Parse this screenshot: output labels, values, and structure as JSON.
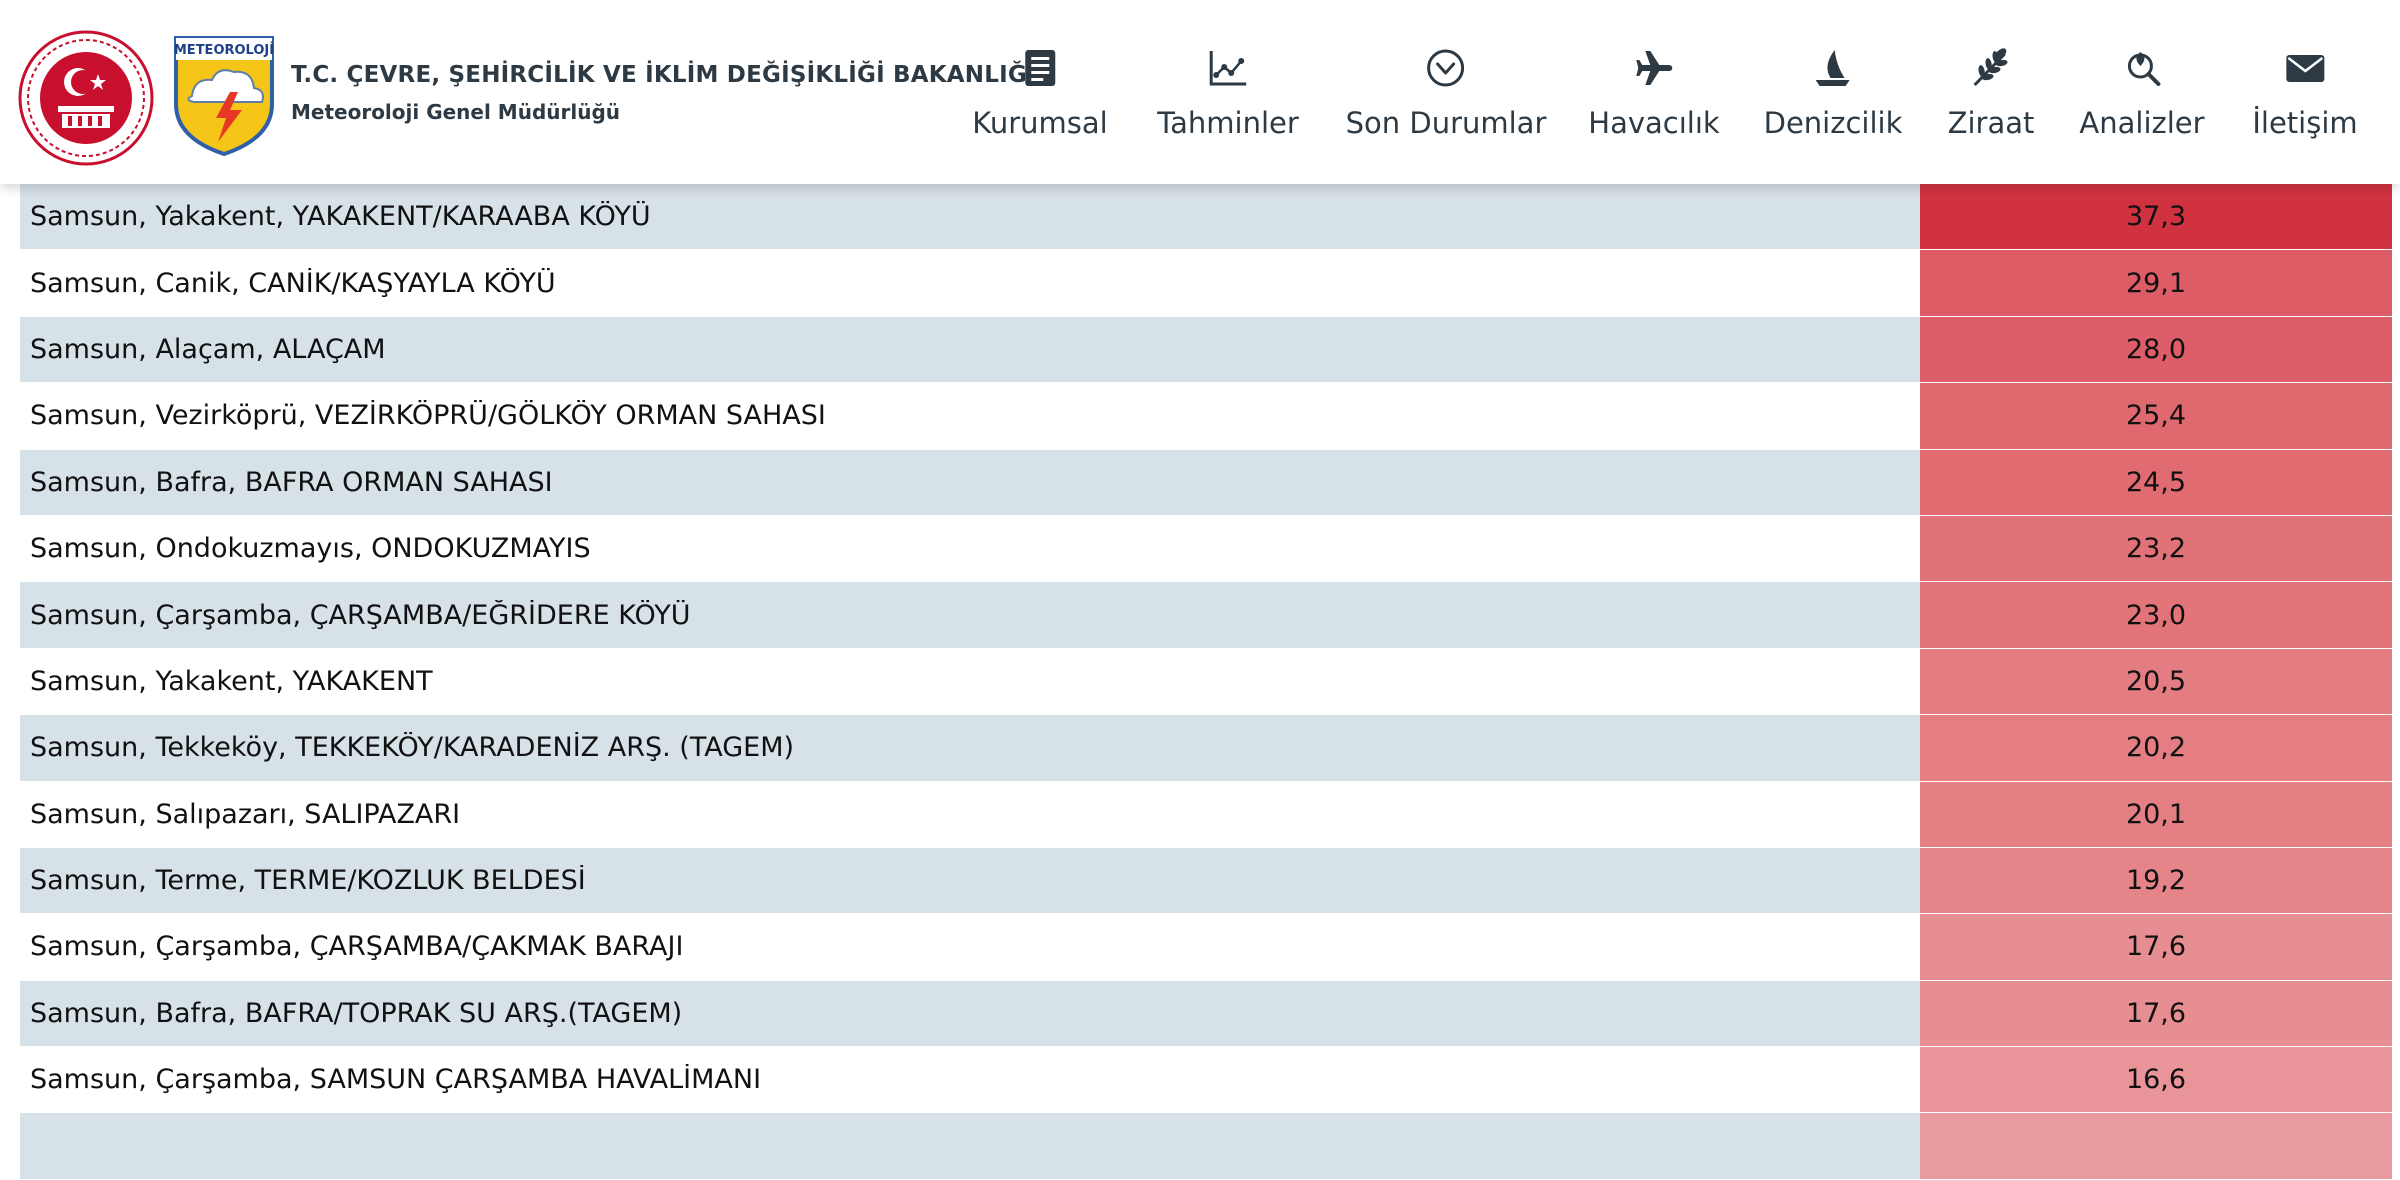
{
  "header": {
    "ministry": "T.C. ÇEVRE, ŞEHİRCİLİK VE İKLİM DEĞİŞİKLİĞİ BAKANLIĞI",
    "directorate": "Meteoroloji Genel Müdürlüğü",
    "logo_text": "METEOROLOJİ"
  },
  "nav": [
    {
      "label": "Kurumsal",
      "icon": "document-icon"
    },
    {
      "label": "Tahminler",
      "icon": "chart-icon"
    },
    {
      "label": "Son Durumlar",
      "icon": "circle-chevron-icon"
    },
    {
      "label": "Havacılık",
      "icon": "airplane-icon"
    },
    {
      "label": "Denizcilik",
      "icon": "sailboat-icon"
    },
    {
      "label": "Ziraat",
      "icon": "wheat-icon"
    },
    {
      "label": "Analizler",
      "icon": "search-leaf-icon"
    },
    {
      "label": "İletişim",
      "icon": "envelope-icon"
    }
  ],
  "colors": {
    "header_text": "#2d3a44",
    "row_alt": "#d7e1e8",
    "value_max": "#d0333f"
  },
  "rows": [
    {
      "location": "Samsun, Yakakent, YAKAKENT/KARAABA KÖYÜ",
      "value": "37,3",
      "color": "#d0333f"
    },
    {
      "location": "Samsun, Canik, CANİK/KAŞYAYLA KÖYÜ",
      "value": "29,1",
      "color": "#dd5c66"
    },
    {
      "location": "Samsun, Alaçam, ALAÇAM",
      "value": "28,0",
      "color": "#dd5e68"
    },
    {
      "location": "Samsun, Vezirköprü, VEZİRKÖPRÜ/GÖLKÖY ORMAN SAHASI",
      "value": "25,4",
      "color": "#e0696f"
    },
    {
      "location": "Samsun, Bafra, BAFRA ORMAN SAHASI",
      "value": "24,5",
      "color": "#e06c72"
    },
    {
      "location": "Samsun, Ondokuzmayıs, ONDOKUZMAYIS",
      "value": "23,2",
      "color": "#e17278"
    },
    {
      "location": "Samsun, Çarşamba, ÇARŞAMBA/EĞRİDERE KÖYÜ",
      "value": "23,0",
      "color": "#e2747a"
    },
    {
      "location": "Samsun, Yakakent, YAKAKENT",
      "value": "20,5",
      "color": "#e47d82"
    },
    {
      "location": "Samsun, Tekkeköy, TEKKEKÖY/KARADENİZ ARŞ. (TAGEM)",
      "value": "20,2",
      "color": "#e47e83"
    },
    {
      "location": "Samsun, Salıpazarı, SALIPAZARI",
      "value": "20,1",
      "color": "#e47f84"
    },
    {
      "location": "Samsun, Terme, TERME/KOZLUK BELDESİ",
      "value": "19,2",
      "color": "#e5858a"
    },
    {
      "location": "Samsun, Çarşamba, ÇARŞAMBA/ÇAKMAK BARAJI",
      "value": "17,6",
      "color": "#e78e92"
    },
    {
      "location": "Samsun, Bafra, BAFRA/TOPRAK SU ARŞ.(TAGEM)",
      "value": "17,6",
      "color": "#e78e92"
    },
    {
      "location": "Samsun, Çarşamba, SAMSUN ÇARŞAMBA HAVALİMANI",
      "value": "16,6",
      "color": "#e89498"
    }
  ]
}
